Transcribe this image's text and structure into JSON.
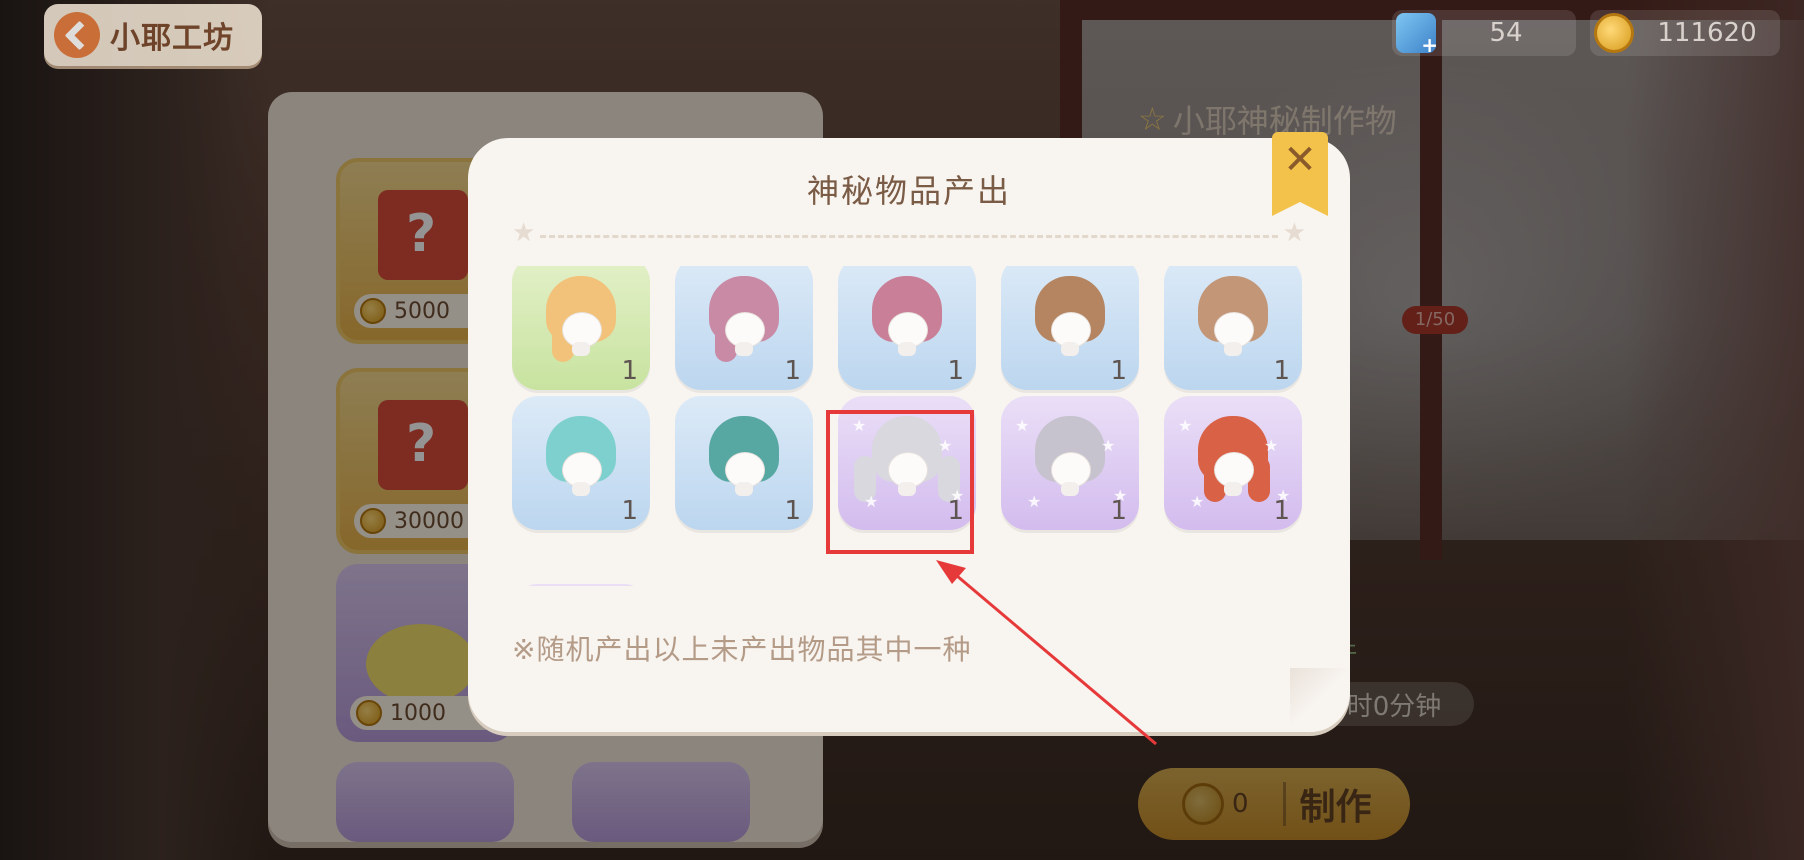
{
  "header": {
    "back_label": "小耶工坊",
    "resources": [
      {
        "icon": "gem-add-icon",
        "value": "54"
      },
      {
        "icon": "coin-icon",
        "value": "111620"
      }
    ]
  },
  "shop": {
    "items": [
      {
        "price": "5000"
      },
      {
        "price": "30000"
      },
      {
        "price": "1000"
      }
    ]
  },
  "side": {
    "title": "小耶神秘制作物",
    "progress": "1/50",
    "count_note": "1件",
    "time_note": "时0分钟",
    "make_count": "0",
    "make_label": "制作"
  },
  "modal": {
    "title": "神秘物品产出",
    "close_label": "✕",
    "note": "※随机产出以上未产出物品其中一种",
    "items": [
      {
        "bg": "green",
        "hair_color": "#f2c27a",
        "qty": "1"
      },
      {
        "bg": "blue",
        "hair_color": "#c98aa5",
        "qty": "1"
      },
      {
        "bg": "blue",
        "hair_color": "#c97f97",
        "qty": "1"
      },
      {
        "bg": "blue",
        "hair_color": "#b58460",
        "qty": "1"
      },
      {
        "bg": "blue",
        "hair_color": "#c29676",
        "qty": "1"
      },
      {
        "bg": "blue",
        "hair_color": "#7ed0ce",
        "qty": "1"
      },
      {
        "bg": "blue",
        "hair_color": "#57a7a3",
        "qty": "1"
      },
      {
        "bg": "purple",
        "hair_color": "#d8d8de",
        "qty": "1",
        "highlighted": true
      },
      {
        "bg": "purple",
        "hair_color": "#c6c3cf",
        "qty": "1"
      },
      {
        "bg": "purple",
        "hair_color": "#d96145",
        "qty": "1"
      }
    ]
  },
  "colors": {
    "highlight": "#e6393a",
    "accent_gold": "#f2c24a",
    "modal_bg": "#f8f4ef"
  }
}
